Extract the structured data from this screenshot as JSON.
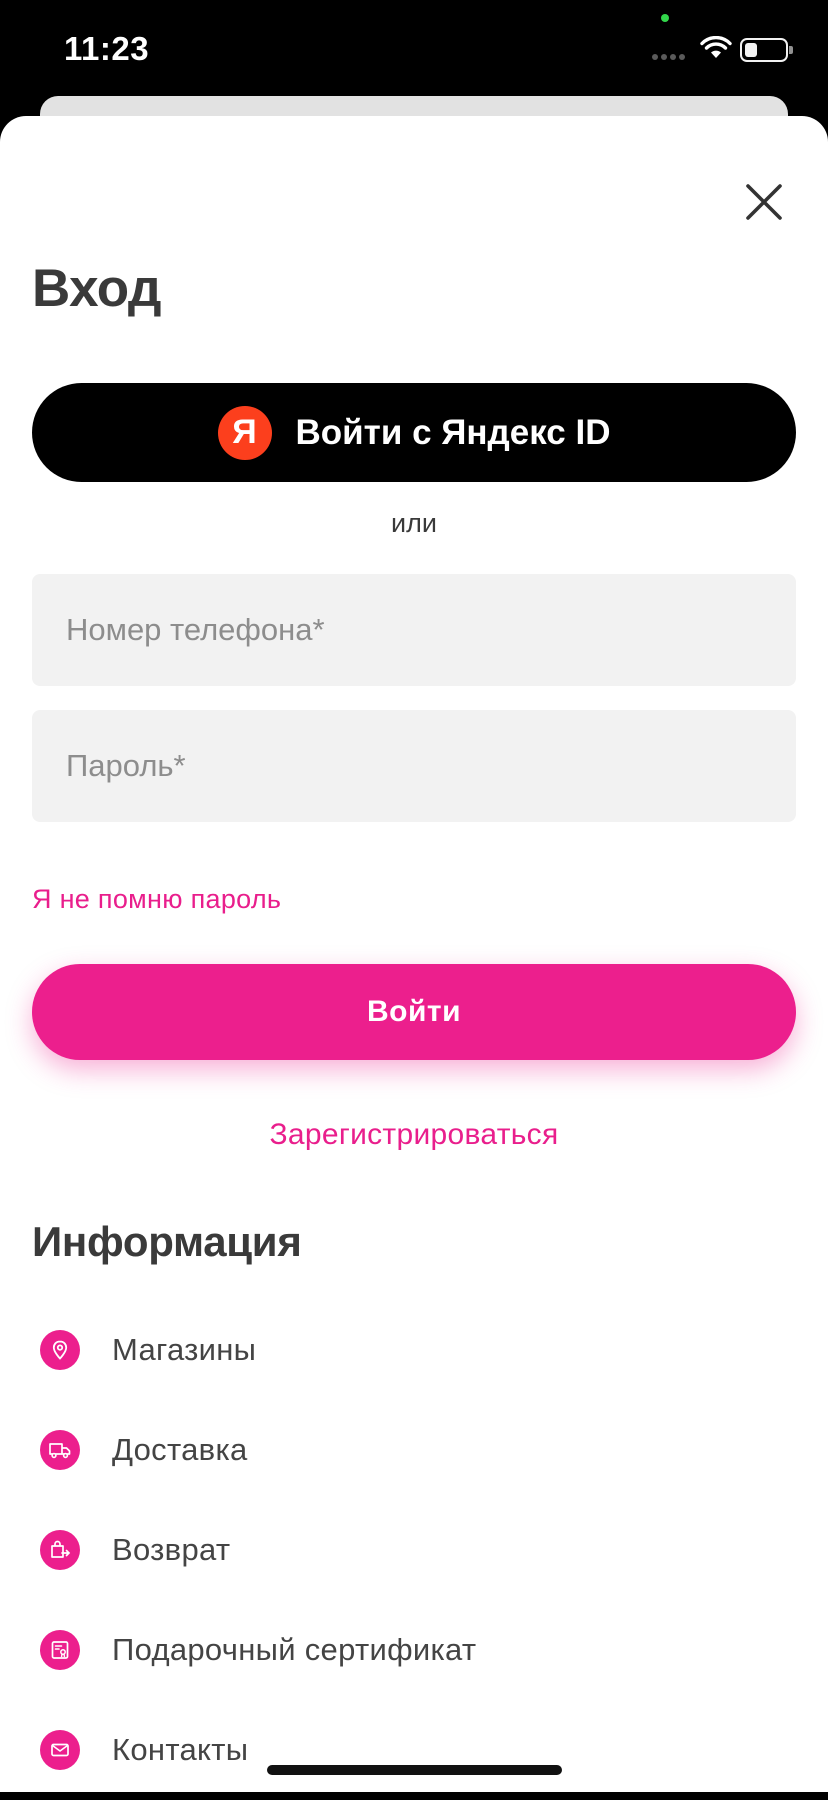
{
  "status_bar": {
    "time": "11:23"
  },
  "login": {
    "title": "Вход",
    "yandex_button": {
      "logo_letter": "Я",
      "label": "Войти с Яндекс ID"
    },
    "or_text": "или",
    "phone_field": {
      "placeholder": "Номер телефона*",
      "value": ""
    },
    "password_field": {
      "placeholder": "Пароль*",
      "value": ""
    },
    "forgot_password": "Я не помню пароль",
    "submit_label": "Войти",
    "register_link": "Зарегистрироваться"
  },
  "info": {
    "title": "Информация",
    "items": [
      {
        "label": "Магазины",
        "icon": "location-pin-icon"
      },
      {
        "label": "Доставка",
        "icon": "truck-icon"
      },
      {
        "label": "Возврат",
        "icon": "return-bag-icon"
      },
      {
        "label": "Подарочный сертификат",
        "icon": "gift-certificate-icon"
      },
      {
        "label": "Контакты",
        "icon": "envelope-icon"
      }
    ]
  },
  "colors": {
    "accent": "#ec1f8d",
    "yandex_red": "#fc3f1d",
    "field_bg": "#f2f2f2"
  }
}
